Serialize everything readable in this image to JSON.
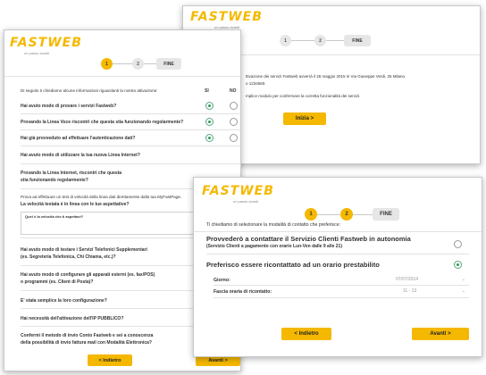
{
  "brand": {
    "logo": "FASTWEB",
    "tagline": "un passo avanti"
  },
  "steps": {
    "one": "1",
    "two": "2",
    "fine": "FINE"
  },
  "win1": {
    "intro": "Di seguito ti chiediamo alcune informazioni riguardanti la nostra attivazione:",
    "col_si": "SI",
    "col_no": "NO",
    "q1": "Hai avuto modo di provare i servizi Fastweb?",
    "q2": "Provando la Linea Voce riscontri che questa stia funzionando regolarmente?",
    "q3": "Hai già provveduto ad effettuare l'autenticazione dati?",
    "q4": "Hai avuto modo di utilizzare la tua nuova Linea Internet?",
    "q5a": "Provando la Linea Internet, riscontri che questa",
    "q5b": "stia funzionando regolarmente?",
    "q6a": "Prova ad effettuare un test di velocità della linea dati direttamente dalla tua MyFastPage.",
    "q6b": "La velocità testata è in linea con le tue aspettative?",
    "speed_label": "Quel è la velocità che ti aspettavi?",
    "q7a": "Hai avuto modo di testare i Servizi Telefonici Supplementari",
    "q7b": "(es. Segreteria Telefonica, Chi Chiama, etc.)?",
    "q8a": "Hai avuto modo di configurare gli apparati esterni (es. fax/POS)",
    "q8b": "o programmi (es. Client di Posta)?",
    "q9": "E' stata semplice la loro configurazione?",
    "q10": "Hai necessità dell'attivazione dell'IP PUBBLICO?",
    "q11a": "Confermi il metodo di invio Conto Fastweb e sei a conoscenza",
    "q11b": "della possibilità di invio fattura mail con Modalità Elettronica?",
    "back": "< Indietro",
    "next": "Avanti >"
  },
  "win2": {
    "line1": "ttivazione dei servizi Fastweb avverrà il 26 maggio 2015 in Via Giuseppe Verdi, 25 Milano.",
    "line2": "o 1234560.",
    "line3": "mplice modulo per confermare la corretta funzionalità dei servizi.",
    "start": "Inizia >"
  },
  "win3": {
    "intro": "Ti chiediamo di selezionare la modalità di contatto che preferisce:",
    "opt1_title": "Provvederò a contattare il Servizio Clienti Fastweb in autonomia",
    "opt1_sub": "(Servizio Clienti a pagamento con orario Lun-Ven dalle 9 alle 21)",
    "opt2_title": "Preferisco essere ricontattato ad un orario prestabilito",
    "giorno_label": "Giorno:",
    "giorno_value": "07/07/2014",
    "fascia_label": "Fascia oraria di ricontatto:",
    "fascia_value": "11 - 13",
    "back": "< Indietro",
    "next": "Avanti >"
  },
  "colors": {
    "accent": "#f5b800",
    "radio_on": "#2f9a58"
  }
}
